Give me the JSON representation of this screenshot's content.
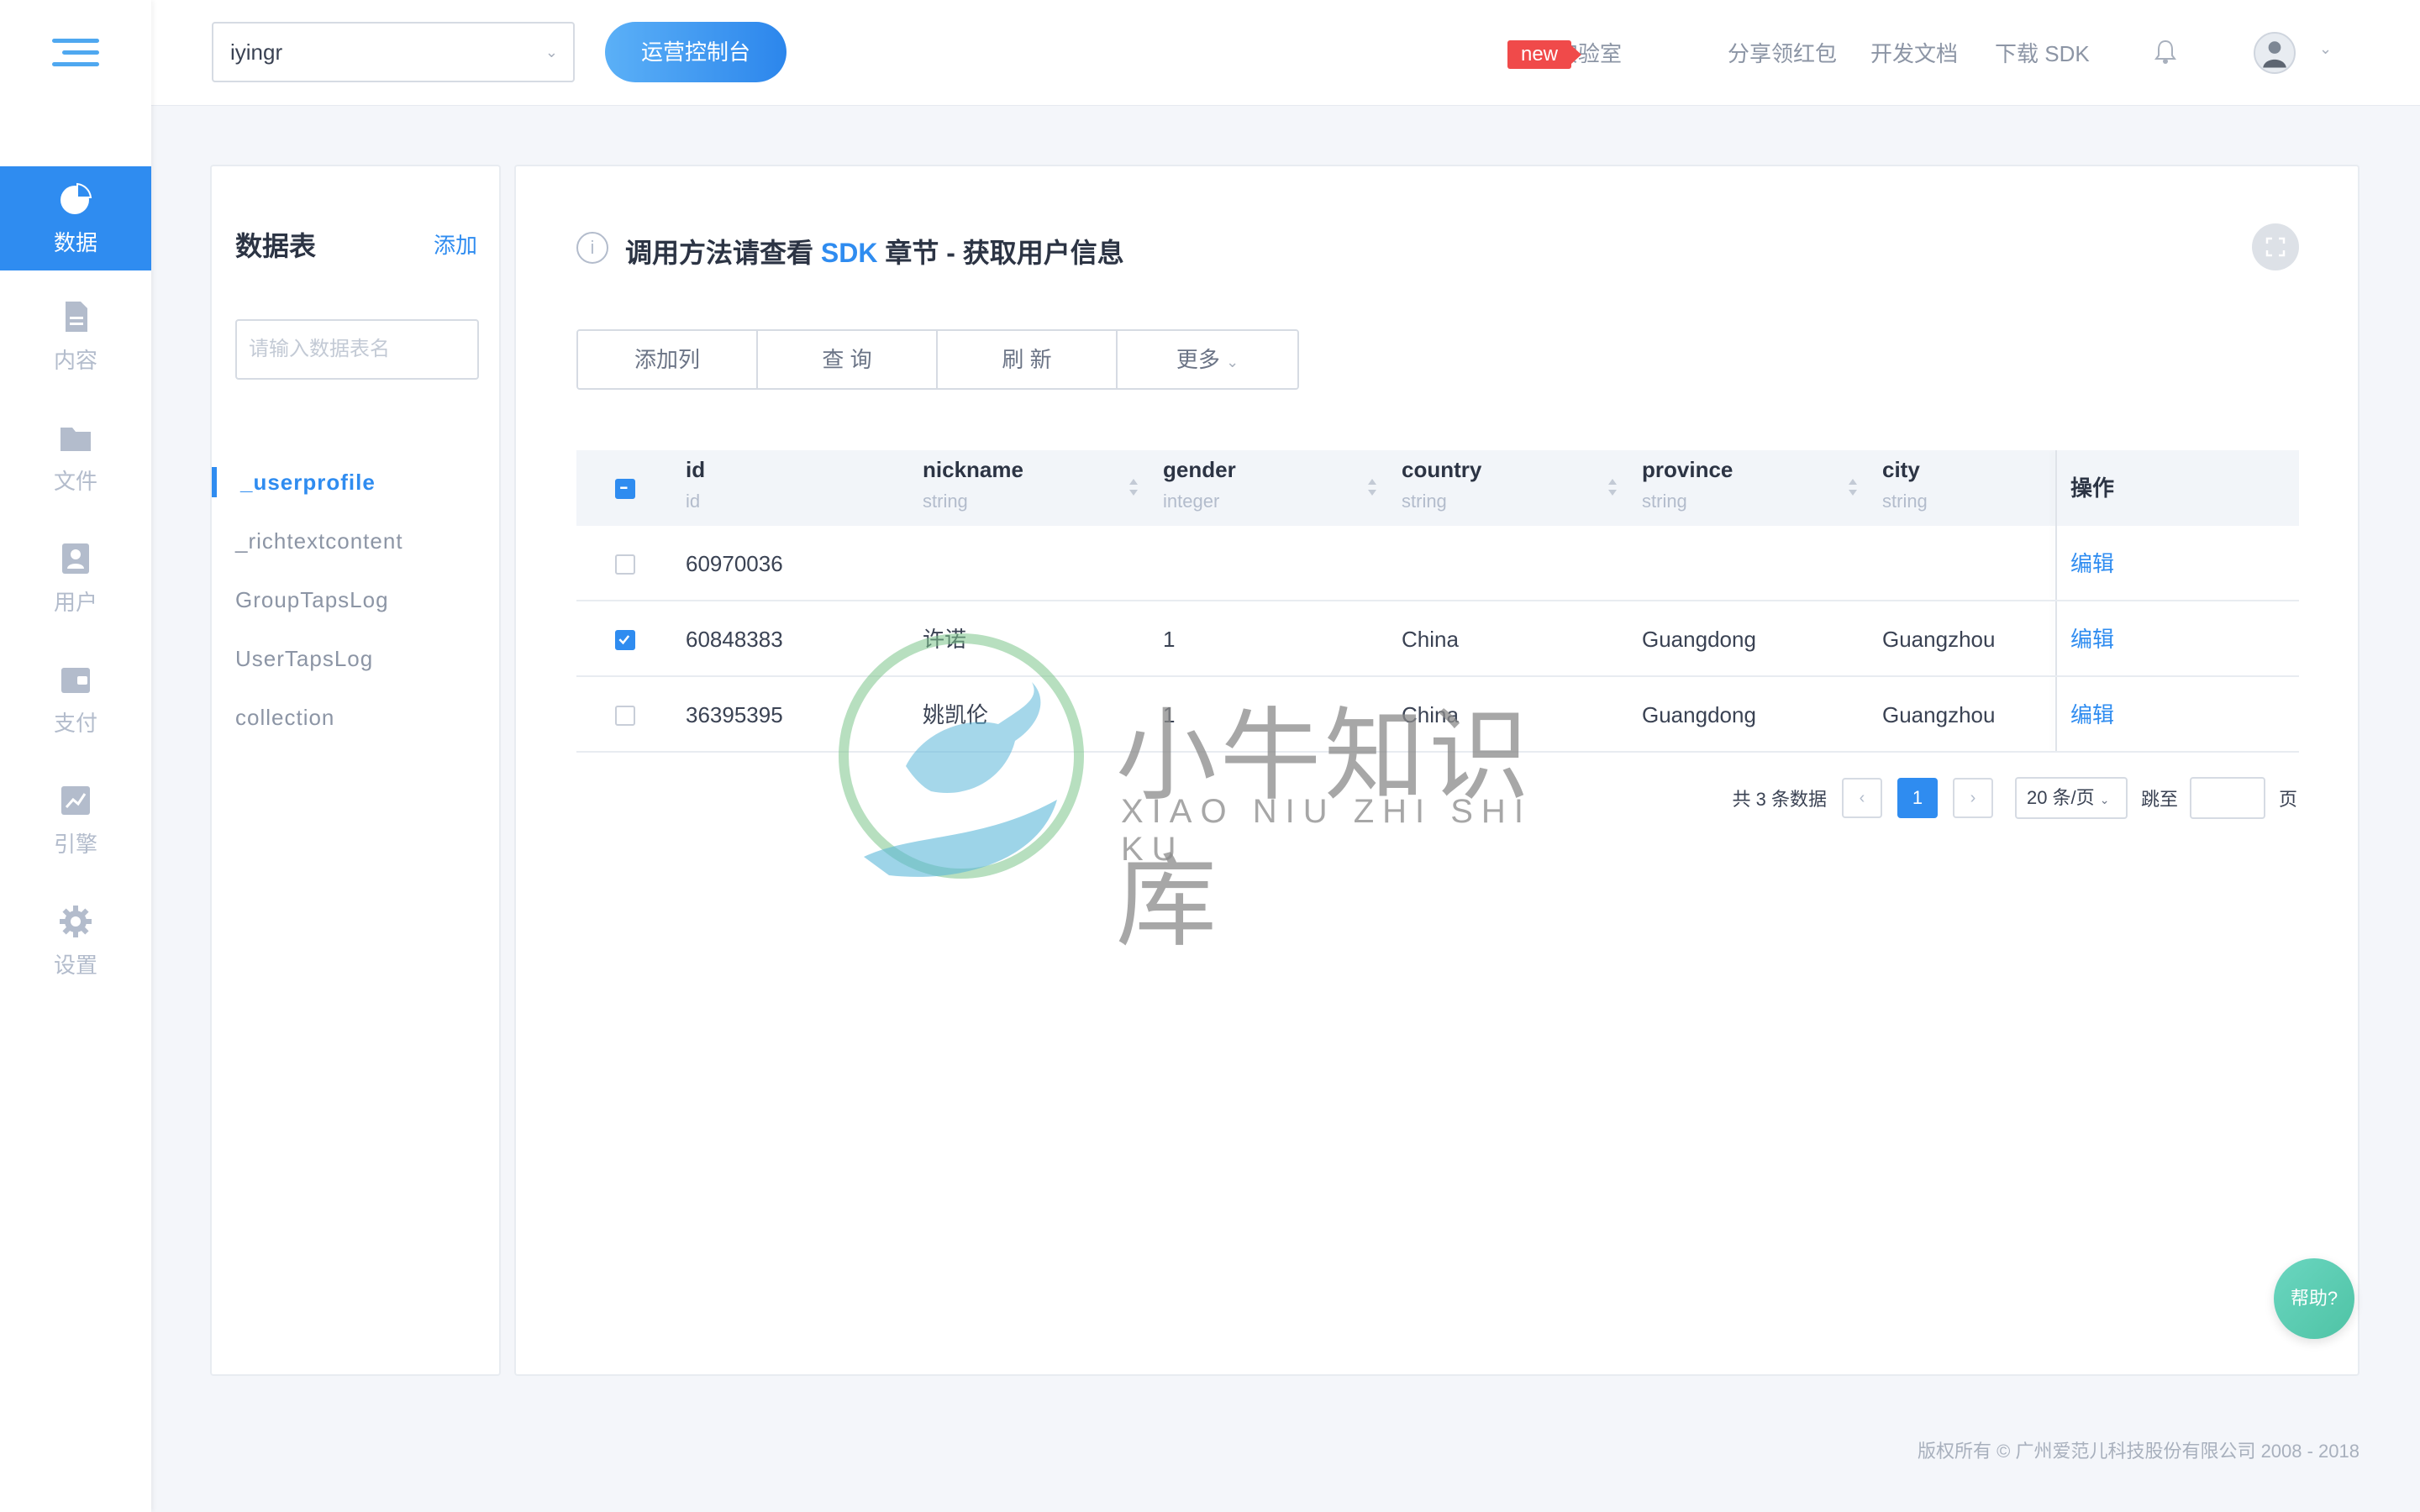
{
  "nav": {
    "items": [
      {
        "label": "数据",
        "icon": "pie-chart-icon",
        "active": true
      },
      {
        "label": "内容",
        "icon": "document-icon",
        "active": false
      },
      {
        "label": "文件",
        "icon": "folder-icon",
        "active": false
      },
      {
        "label": "用户",
        "icon": "user-card-icon",
        "active": false
      },
      {
        "label": "支付",
        "icon": "wallet-icon",
        "active": false
      },
      {
        "label": "引擎",
        "icon": "trend-chart-icon",
        "active": false
      },
      {
        "label": "设置",
        "icon": "gear-icon",
        "active": false
      }
    ]
  },
  "header": {
    "app_selector_value": "iyingr",
    "console_button": "运营控制台",
    "links": {
      "lab": "实验室",
      "new_badge": "new",
      "share": "分享领红包",
      "docs": "开发文档",
      "sdk": "下载 SDK"
    }
  },
  "tables_panel": {
    "title": "数据表",
    "add": "添加",
    "search_placeholder": "请输入数据表名",
    "items": [
      "_userprofile",
      "_richtextcontent",
      "GroupTapsLog",
      "UserTapsLog",
      "collection"
    ]
  },
  "main": {
    "info_prefix": "调用方法请查看 ",
    "info_highlight": "SDK",
    "info_suffix": " 章节 - 获取用户信息",
    "buttons": {
      "add_column": "添加列",
      "query": "查 询",
      "refresh": "刷 新",
      "more": "更多"
    },
    "table": {
      "columns": [
        {
          "name": "id",
          "type": "id"
        },
        {
          "name": "nickname",
          "type": "string"
        },
        {
          "name": "gender",
          "type": "integer"
        },
        {
          "name": "country",
          "type": "string"
        },
        {
          "name": "province",
          "type": "string"
        },
        {
          "name": "city",
          "type": "string"
        }
      ],
      "ops_header": "操作",
      "rows": [
        {
          "id": "60970036",
          "nickname": "",
          "gender": "",
          "country": "",
          "province": "",
          "city": "",
          "op": "编辑",
          "checked": false
        },
        {
          "id": "60848383",
          "nickname": "许诺",
          "gender": "1",
          "country": "China",
          "province": "Guangdong",
          "city": "Guangzhou",
          "op": "编辑",
          "checked": true
        },
        {
          "id": "36395395",
          "nickname": "姚凯伦",
          "gender": "1",
          "country": "China",
          "province": "Guangdong",
          "city": "Guangzhou",
          "op": "编辑",
          "checked": false
        }
      ]
    },
    "pagination": {
      "total_text": "共 3 条数据",
      "current_page": "1",
      "page_size": "20 条/页",
      "jump_label": "跳至",
      "page_suffix": "页"
    }
  },
  "watermark": {
    "title": "小牛知识库",
    "subtitle": "XIAO NIU ZHI SHI KU"
  },
  "help_button": "帮助?",
  "footer": "版权所有 © 广州爱范儿科技股份有限公司 2008 - 2018",
  "colors": {
    "accent": "#2f8cf0",
    "badge": "#f04a4a",
    "help": "#4fc3a5"
  }
}
